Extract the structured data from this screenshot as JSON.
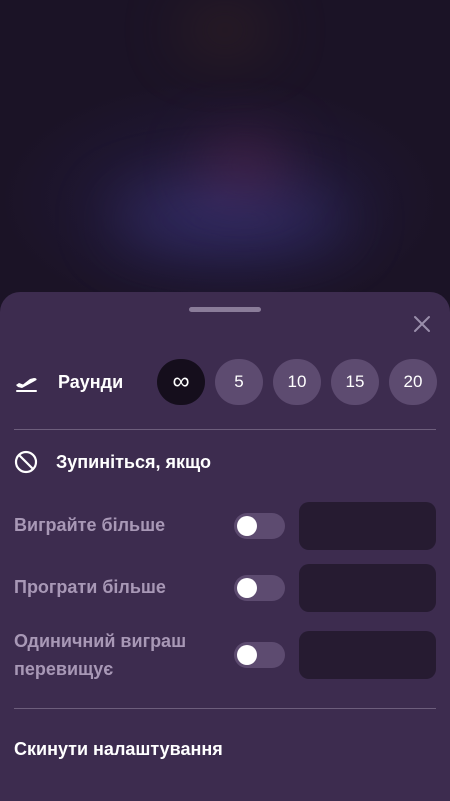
{
  "sheet": {
    "rounds": {
      "label": "Раунди",
      "options": [
        "∞",
        "5",
        "10",
        "15",
        "20"
      ],
      "selected_index": 0
    },
    "stop_if": {
      "title": "Зупиніться, якщо",
      "conditions": [
        {
          "label": "Виграйте більше",
          "enabled": false,
          "value": ""
        },
        {
          "label": "Програти більше",
          "enabled": false,
          "value": ""
        },
        {
          "label": "Одиничний виграш перевищує",
          "enabled": false,
          "value": ""
        }
      ]
    },
    "reset_label": "Скинути налаштування"
  },
  "colors": {
    "sheet_bg": "#3d2c4f",
    "chip_bg": "#5d4b70",
    "chip_selected_bg": "#150e1c",
    "input_bg": "#261b31",
    "muted_text": "#a898b6"
  },
  "icons": {
    "rounds": "plane-takeoff-icon",
    "stop": "prohibited-icon",
    "close": "close-icon"
  }
}
